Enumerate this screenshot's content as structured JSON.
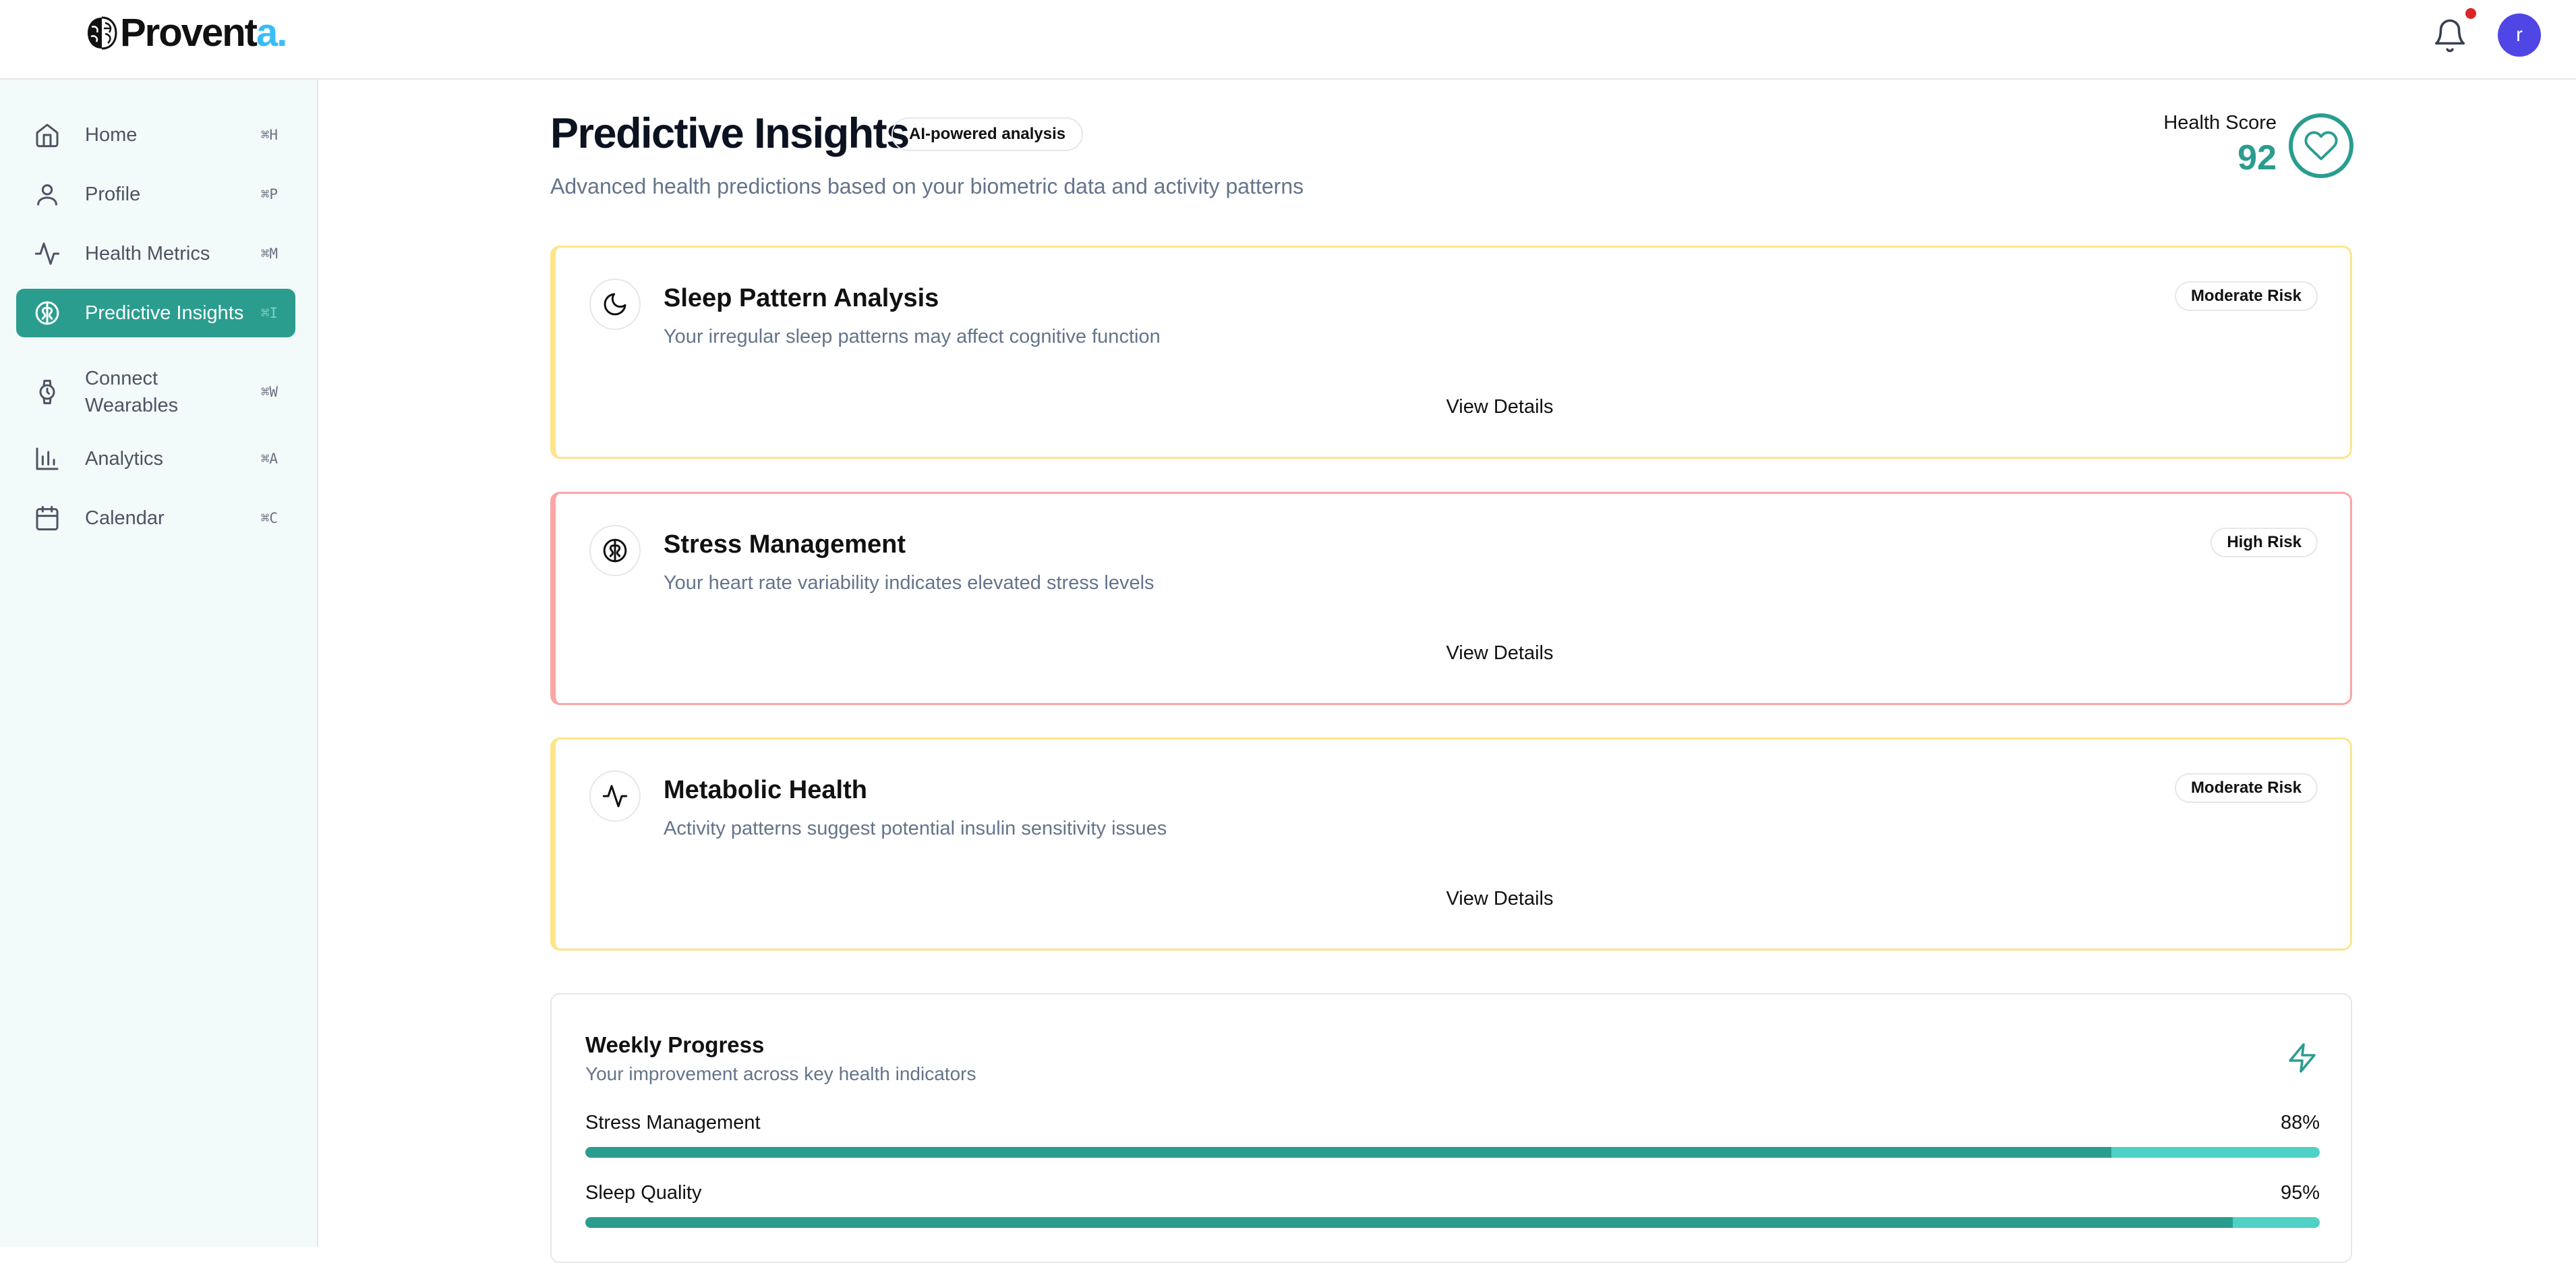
{
  "app": {
    "logo_text_main": "Proventa",
    "logo_text_start": "Provent",
    "logo_text_accent": "a.",
    "avatar_initial": "r",
    "notification_dot": true
  },
  "sidebar": {
    "items": [
      {
        "label": "Home",
        "shortcut": "⌘H",
        "icon": "home-icon",
        "active": false
      },
      {
        "label": "Profile",
        "shortcut": "⌘P",
        "icon": "user-icon",
        "active": false
      },
      {
        "label": "Health Metrics",
        "shortcut": "⌘M",
        "icon": "activity-icon",
        "active": false
      },
      {
        "label": "Predictive Insights",
        "shortcut": "⌘I",
        "icon": "brain-icon",
        "active": true
      },
      {
        "label": "Connect Wearables",
        "shortcut": "⌘W",
        "icon": "watch-icon",
        "active": false
      },
      {
        "label": "Analytics",
        "shortcut": "⌘A",
        "icon": "bar-chart-icon",
        "active": false
      },
      {
        "label": "Calendar",
        "shortcut": "⌘C",
        "icon": "calendar-icon",
        "active": false
      }
    ]
  },
  "header": {
    "title": "Predictive Insights",
    "badge": "AI-powered analysis",
    "subtitle": "Advanced health predictions based on your biometric data and activity patterns",
    "health_score_label": "Health Score",
    "health_score_value": "92"
  },
  "insights": [
    {
      "title": "Sleep Pattern Analysis",
      "description": "Your irregular sleep patterns may affect cognitive function",
      "risk": "Moderate Risk",
      "action": "View Details",
      "icon": "moon-icon"
    },
    {
      "title": "Stress Management",
      "description": "Your heart rate variability indicates elevated stress levels",
      "risk": "High Risk",
      "action": "View Details",
      "icon": "brain-icon"
    },
    {
      "title": "Metabolic Health",
      "description": "Activity patterns suggest potential insulin sensitivity issues",
      "risk": "Moderate Risk",
      "action": "View Details",
      "icon": "activity-icon"
    }
  ],
  "weekly_progress": {
    "title": "Weekly Progress",
    "subtitle": "Your improvement across key health indicators",
    "metrics": [
      {
        "label": "Stress Management",
        "percent_label": "88%",
        "value": 0.88
      },
      {
        "label": "Sleep Quality",
        "percent_label": "95%",
        "value": 0.95
      }
    ]
  },
  "colors": {
    "accent": "#2a9d8f",
    "moderate_border": "#fde68a",
    "high_border": "#fca5a5",
    "avatar": "#4f46e5",
    "notification": "#dc2626"
  }
}
